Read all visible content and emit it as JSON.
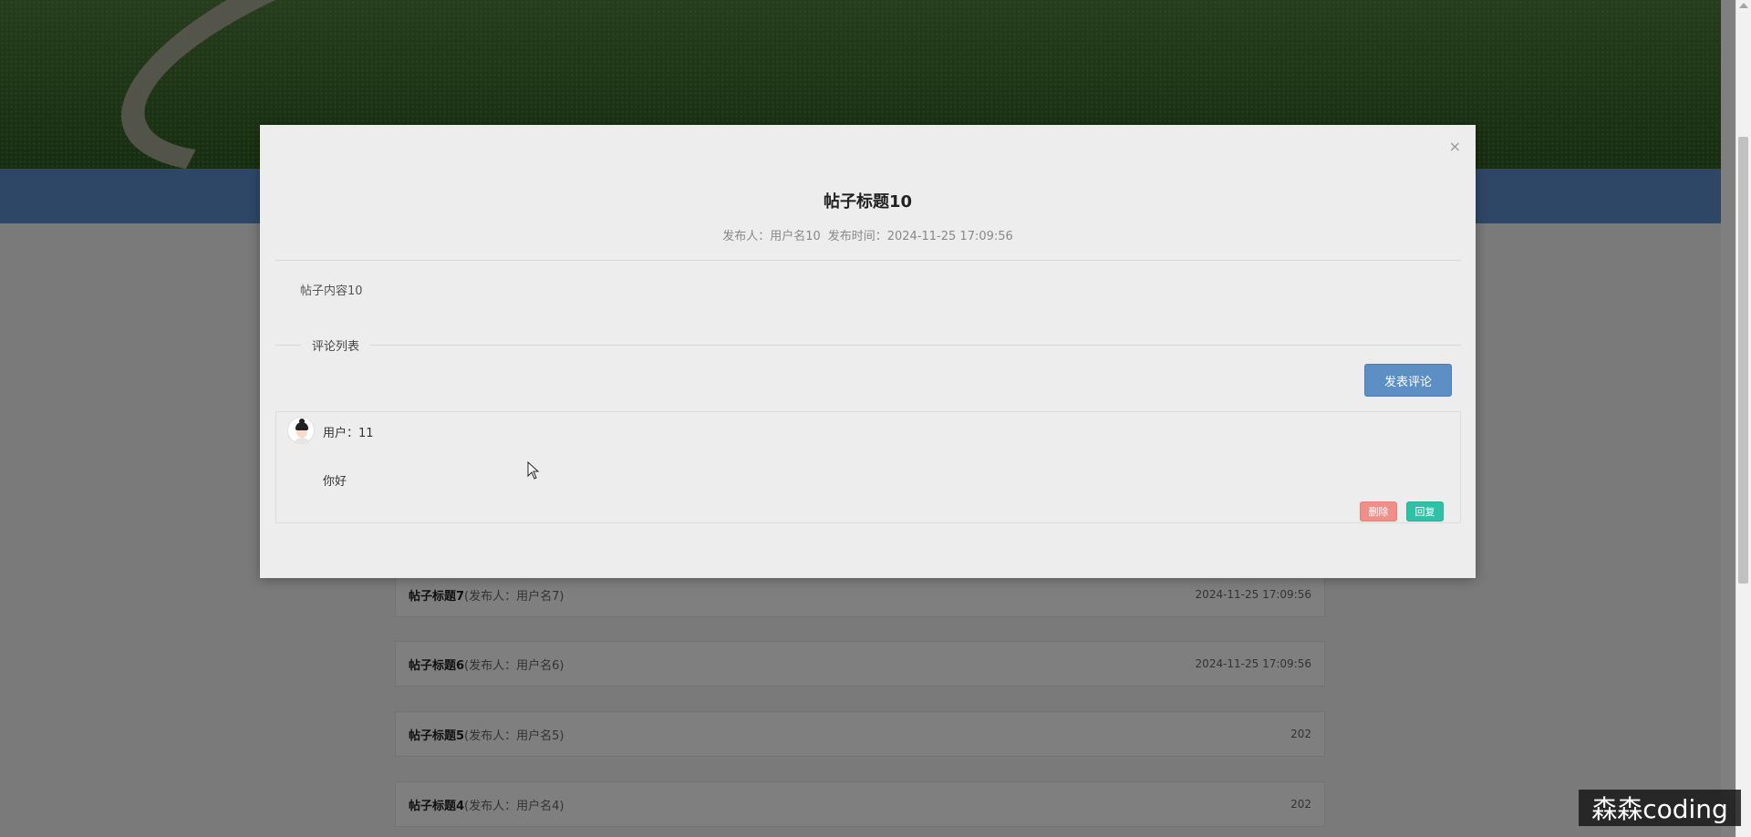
{
  "modal": {
    "close_label": "×",
    "title": "帖子标题10",
    "publisher": "发布人：用户名10",
    "publish_time": "发布时间：2024-11-25 17:09:56",
    "content": "帖子内容10",
    "comment_section_label": "评论列表",
    "publish_comment_button": "发表评论",
    "comments": [
      {
        "user": "用户：11",
        "text": "你好",
        "delete_label": "删除",
        "reply_label": "回复"
      }
    ]
  },
  "post_list": [
    {
      "title": "帖子标题7",
      "publisher": "(发布人：用户名7)",
      "time": "2024-11-25 17:09:56"
    },
    {
      "title": "帖子标题6",
      "publisher": "(发布人：用户名6)",
      "time": "2024-11-25 17:09:56"
    },
    {
      "title": "帖子标题5",
      "publisher": "(发布人：用户名5)",
      "time": "202"
    },
    {
      "title": "帖子标题4",
      "publisher": "(发布人：用户名4)",
      "time": "202"
    }
  ],
  "watermark": "森森coding",
  "colors": {
    "navbar": "#5d8fcc",
    "publish_button": "#5d8fc4",
    "delete_button": "#f08e8a",
    "reply_button": "#2ec1a6"
  },
  "icons": {
    "close": "close-icon",
    "cursor": "mouse-cursor-icon",
    "avatar": "user-avatar"
  }
}
